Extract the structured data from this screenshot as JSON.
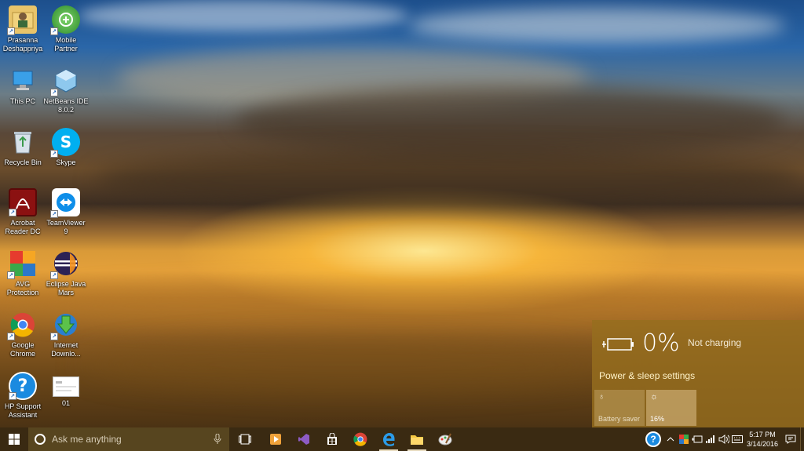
{
  "desktop": {
    "icons": [
      {
        "label": "Prasanna\nDeshappriya",
        "icon": "user-folder-icon"
      },
      {
        "label": "Mobile\nPartner",
        "icon": "mobile-partner-icon"
      },
      {
        "label": "This PC",
        "icon": "computer-icon"
      },
      {
        "label": "NetBeans IDE\n8.0.2",
        "icon": "netbeans-icon"
      },
      {
        "label": "Recycle Bin",
        "icon": "recycle-bin-icon"
      },
      {
        "label": "Skype",
        "icon": "skype-icon"
      },
      {
        "label": "Acrobat\nReader DC",
        "icon": "acrobat-icon"
      },
      {
        "label": "TeamViewer\n9",
        "icon": "teamviewer-icon"
      },
      {
        "label": "AVG\nProtection",
        "icon": "avg-icon"
      },
      {
        "label": "Eclipse Java\nMars",
        "icon": "eclipse-icon"
      },
      {
        "label": "Google\nChrome",
        "icon": "chrome-icon"
      },
      {
        "label": "Internet\nDownlo...",
        "icon": "internet-download-manager-icon"
      },
      {
        "label": "HP Support\nAssistant",
        "icon": "hp-support-icon"
      },
      {
        "label": "01",
        "icon": "document-icon"
      }
    ]
  },
  "battery_flyout": {
    "percent": "0%",
    "status": "Not charging",
    "settings_link": "Power & sleep settings",
    "tiles": {
      "battery_saver": "Battery saver",
      "brightness": "16%"
    }
  },
  "taskbar": {
    "search_placeholder": "Ask me anything",
    "pinned": [
      "task-view-icon",
      "media-player-icon",
      "visual-studio-icon",
      "store-icon",
      "chrome-icon",
      "edge-icon",
      "file-explorer-icon",
      "paint-icon"
    ],
    "clock": {
      "time": "5:17 PM",
      "date": "3/14/2016"
    }
  },
  "colors": {
    "flyout_bg": "#966e1e",
    "taskbar_bg": "#3a2a12",
    "search_bg": "#57451f"
  }
}
